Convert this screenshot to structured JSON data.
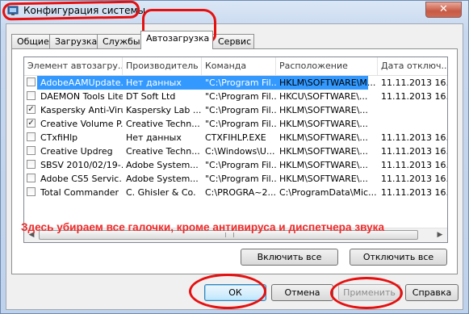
{
  "window": {
    "title": "Конфигурация системы",
    "close_glyph": "✕"
  },
  "tabs": [
    {
      "label": "Общие"
    },
    {
      "label": "Загрузка"
    },
    {
      "label": "Службы"
    },
    {
      "label": "Автозагрузка",
      "active": true
    },
    {
      "label": "Сервис"
    }
  ],
  "columns": [
    "Элемент автозагру...",
    "Производитель",
    "Команда",
    "Расположение",
    "Дата отключ..."
  ],
  "rows": [
    {
      "checked": false,
      "selected": true,
      "cells": [
        "AdobeAAMUpdate...",
        "Нет данных",
        "\"C:\\Program Fil...",
        "HKLM\\SOFTWARE\\M...",
        "11.11.2013 16..."
      ]
    },
    {
      "checked": false,
      "selected": false,
      "cells": [
        "DAEMON Tools Lite",
        "DT Soft Ltd",
        "\"C:\\Program Fil...",
        "HKCU\\SOFTWARE\\...",
        "11.11.2013 16..."
      ]
    },
    {
      "checked": true,
      "selected": false,
      "cells": [
        "Kaspersky Anti-Virus",
        "Kaspersky Lab ...",
        "\"C:\\Program Fil...",
        "HKLM\\SOFTWARE\\...",
        ""
      ]
    },
    {
      "checked": true,
      "selected": false,
      "cells": [
        "Creative Volume P...",
        "Creative Techn...",
        "\"C:\\Program Fil...",
        "HKLM\\SOFTWARE\\...",
        ""
      ]
    },
    {
      "checked": false,
      "selected": false,
      "cells": [
        "CTxfiHlp",
        "Нет данных",
        "CTXFIHLP.EXE",
        "HKLM\\SOFTWARE\\...",
        "11.11.2013 16..."
      ]
    },
    {
      "checked": false,
      "selected": false,
      "cells": [
        "Creative Updreg",
        "Creative Techn...",
        "C:\\Windows\\U...",
        "HKLM\\SOFTWARE\\...",
        "11.11.2013 16..."
      ]
    },
    {
      "checked": false,
      "selected": false,
      "cells": [
        "SBSV 2010/02/19-...",
        "Adobe System...",
        "\"C:\\Program Fil...",
        "HKLM\\SOFTWARE\\...",
        "11.11.2013 16..."
      ]
    },
    {
      "checked": false,
      "selected": false,
      "cells": [
        "Adobe CS5 Servic...",
        "Adobe System...",
        "\"C:\\Program Fil...",
        "HKLM\\SOFTWARE\\...",
        "11.11.2013 16..."
      ]
    },
    {
      "checked": false,
      "selected": false,
      "cells": [
        "Total Commander",
        "C. Ghisler & Co.",
        "C:\\PROGRA~2...",
        "C:\\ProgramData\\Mic...",
        "11.11.2013 16..."
      ]
    }
  ],
  "annotation": "Здесь убираем все галочки, кроме антивируса и диспетчера звука",
  "buttons": {
    "enable_all": "Включить все",
    "disable_all": "Отключить все",
    "ok": "ОК",
    "cancel": "Отмена",
    "apply": "Применить",
    "help": "Справка"
  },
  "colors": {
    "selection": "#3399ff",
    "annotation": "#ee2a2a"
  }
}
